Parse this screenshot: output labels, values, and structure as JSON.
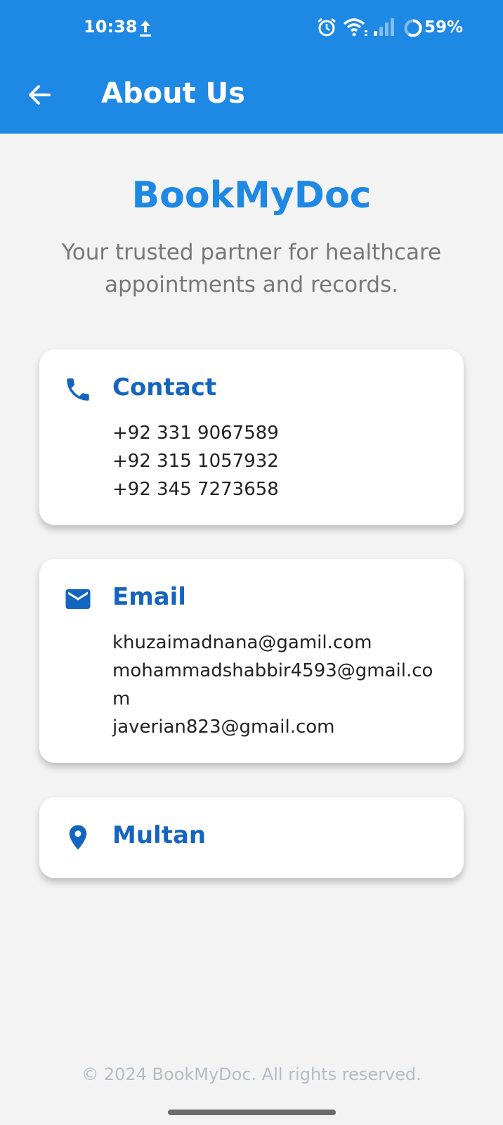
{
  "status_bar": {
    "time": "10:38",
    "battery": "59%",
    "icons": [
      "upload-icon",
      "alarm-icon",
      "wifi-icon",
      "signal-icon",
      "battery-icon"
    ]
  },
  "toolbar": {
    "title": "About Us",
    "back_icon": "arrow-back-icon"
  },
  "brand": {
    "name": "BookMyDoc",
    "tagline": "Your trusted partner for healthcare appointments and records."
  },
  "contact": {
    "title": "Contact",
    "icon": "phone-icon",
    "phones": [
      "+92 331 9067589",
      "+92 315 1057932",
      "+92 345 7273658"
    ]
  },
  "email": {
    "title": "Email",
    "icon": "mail-icon",
    "addresses": [
      "khuzaimadnana@gamil.com",
      "mohammadshabbir4593@gmail.com",
      "javerian823@gmail.com"
    ]
  },
  "location": {
    "title": "Multan",
    "icon": "location-pin-icon"
  },
  "footer": {
    "copyright": "© 2024 BookMyDoc. All rights reserved."
  },
  "colors": {
    "primary": "#1e88e5",
    "card_title": "#1565c0",
    "background": "#f3f3f3"
  }
}
